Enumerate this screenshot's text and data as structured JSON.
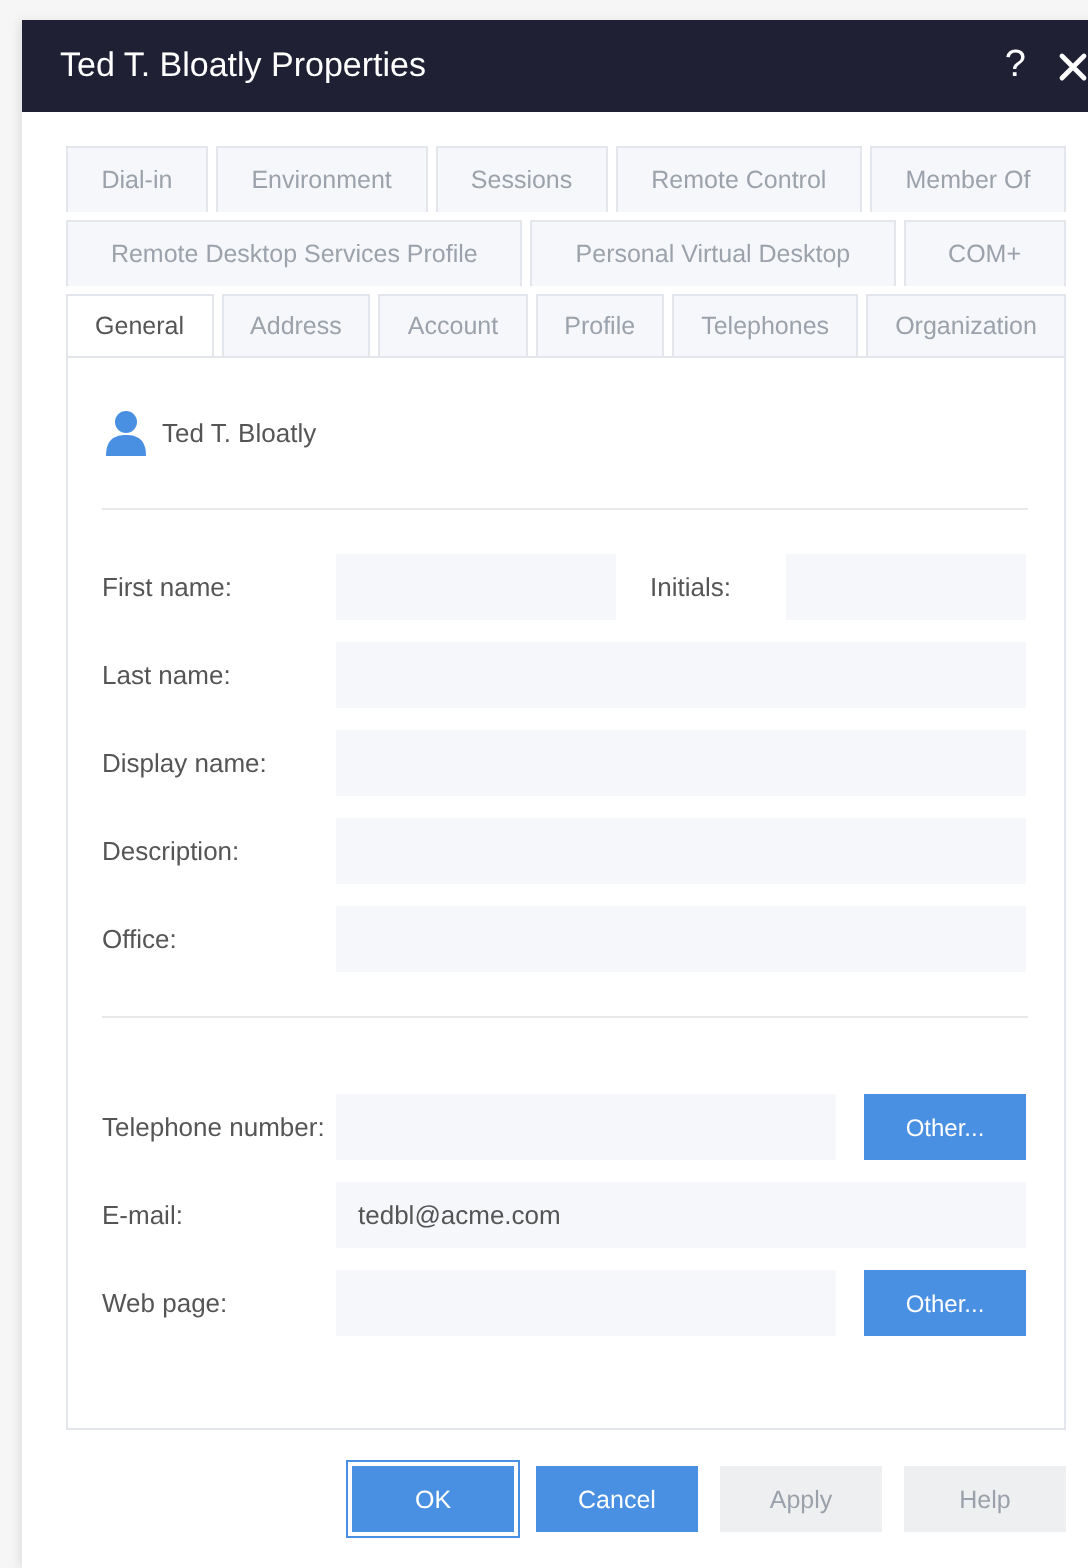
{
  "window": {
    "title": "Ted T. Bloatly Properties",
    "help": "?"
  },
  "tab_rows": [
    [
      {
        "label": "Dial-in",
        "selected": false
      },
      {
        "label": "Environment",
        "selected": false
      },
      {
        "label": "Sessions",
        "selected": false
      },
      {
        "label": "Remote Control",
        "selected": false
      },
      {
        "label": "Member Of",
        "selected": false
      }
    ],
    [
      {
        "label": "Remote Desktop Services Profile",
        "selected": false
      },
      {
        "label": "Personal Virtual Desktop",
        "selected": false
      },
      {
        "label": "COM+",
        "selected": false
      }
    ],
    [
      {
        "label": "General",
        "selected": true
      },
      {
        "label": "Address",
        "selected": false
      },
      {
        "label": "Account",
        "selected": false
      },
      {
        "label": "Profile",
        "selected": false
      },
      {
        "label": "Telephones",
        "selected": false
      },
      {
        "label": "Organization",
        "selected": false
      }
    ]
  ],
  "user": {
    "name": "Ted T. Bloatly"
  },
  "sections": [
    [
      {
        "kind": "split",
        "label": "First name:",
        "second_label": "Initials:"
      },
      {
        "kind": "text",
        "label": "Last name:"
      },
      {
        "kind": "text",
        "label": "Display name:"
      },
      {
        "kind": "text",
        "label": "Description:"
      },
      {
        "kind": "text",
        "label": "Office:"
      }
    ],
    [
      {
        "kind": "button",
        "label": "Telephone number:",
        "button": "Other..."
      },
      {
        "kind": "text",
        "label": "E-mail:",
        "value": "tedbl@acme.com"
      },
      {
        "kind": "button",
        "label": "Web page:",
        "button": "Other..."
      }
    ]
  ],
  "buttons": [
    {
      "label": "OK",
      "disabled": false,
      "default": true
    },
    {
      "label": "Cancel",
      "disabled": false,
      "default": false
    },
    {
      "label": "Apply",
      "disabled": true,
      "default": false
    },
    {
      "label": "Help",
      "disabled": true,
      "default": false
    }
  ]
}
